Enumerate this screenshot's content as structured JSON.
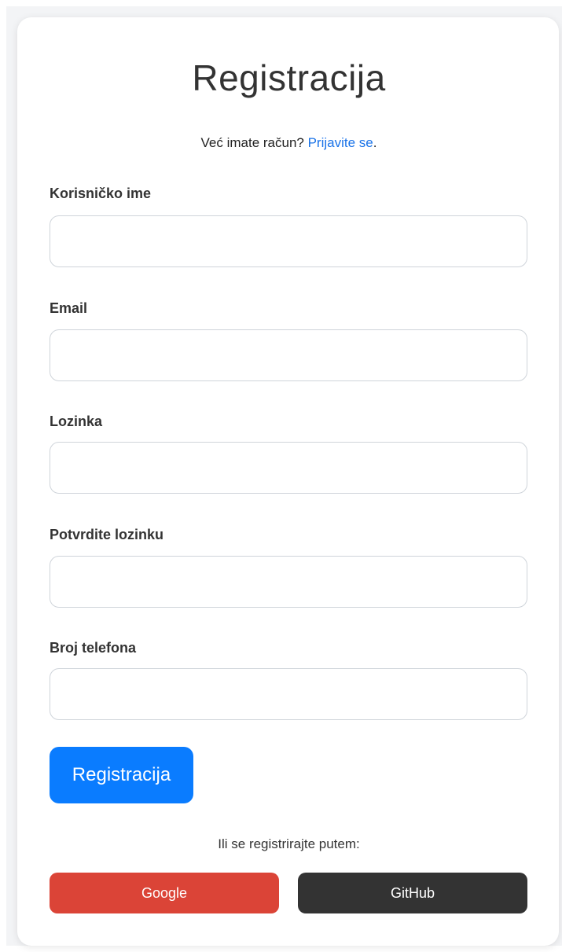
{
  "header": {
    "title": "Registracija"
  },
  "signin": {
    "prefix": "Već imate račun? ",
    "link": "Prijavite se",
    "suffix": "."
  },
  "form": {
    "username_label": "Korisničko ime",
    "username_value": "",
    "email_label": "Email",
    "email_value": "",
    "password_label": "Lozinka",
    "password_value": "",
    "confirm_label": "Potvrdite lozinku",
    "confirm_value": "",
    "phone_label": "Broj telefona",
    "phone_value": "",
    "submit_label": "Registracija"
  },
  "social": {
    "intro": "Ili se registrirajte putem:",
    "google_label": "Google",
    "github_label": "GitHub"
  },
  "colors": {
    "primary": "#0a7cff",
    "google": "#db4437",
    "github": "#333333",
    "link": "#1a73e8"
  }
}
